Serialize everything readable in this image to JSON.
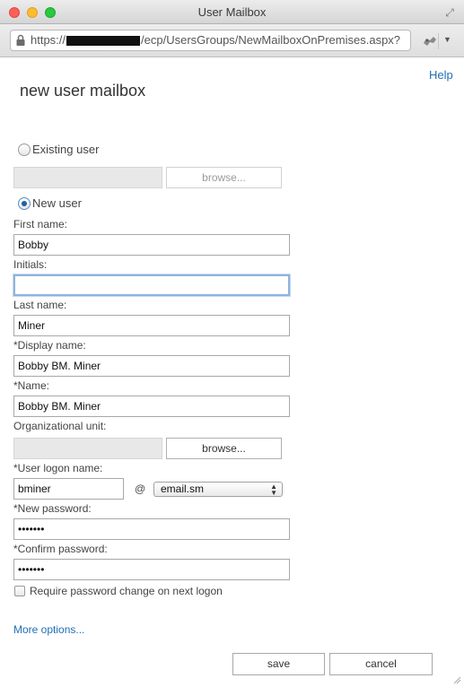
{
  "window": {
    "title": "User Mailbox",
    "url_prefix": "https://",
    "url_path": "/ecp/UsersGroups/NewMailboxOnPremises.aspx?"
  },
  "help_label": "Help",
  "page_title": "new user mailbox",
  "existing_user": {
    "label": "Existing user",
    "selected": false,
    "browse_label": "browse..."
  },
  "new_user": {
    "label": "New user",
    "selected": true
  },
  "fields": {
    "first_name": {
      "label": "First name:",
      "value": "Bobby"
    },
    "initials": {
      "label": "Initials:",
      "value": ""
    },
    "last_name": {
      "label": "Last name:",
      "value": "Miner"
    },
    "display_name": {
      "label": "*Display name:",
      "value": "Bobby BM. Miner"
    },
    "name": {
      "label": "*Name:",
      "value": "Bobby BM. Miner"
    },
    "org_unit": {
      "label": "Organizational unit:",
      "browse_label": "browse..."
    },
    "logon_name": {
      "label": "*User logon name:",
      "value": "bminer",
      "at": "@",
      "domain": "email.sm"
    },
    "new_password": {
      "label": "*New password:",
      "value": "•••••••"
    },
    "confirm_password": {
      "label": "*Confirm password:",
      "value": "•••••••"
    }
  },
  "require_change": {
    "label": "Require password change on next logon",
    "checked": false
  },
  "more_options_label": "More options...",
  "buttons": {
    "save": "save",
    "cancel": "cancel"
  },
  "colors": {
    "link": "#1f6fb5",
    "focus": "#8fb3dc"
  }
}
